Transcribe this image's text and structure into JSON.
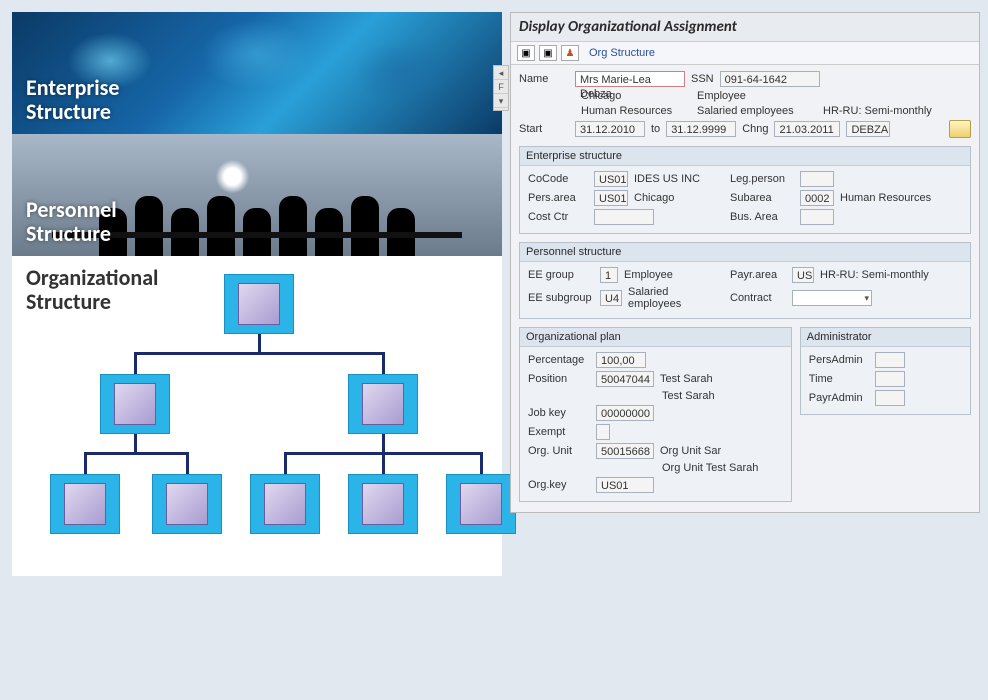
{
  "left": {
    "enterprise_label": "Enterprise\nStructure",
    "personnel_label": "Personnel\nStructure",
    "org_label": "Organizational\nStructure"
  },
  "sap": {
    "title": "Display Organizational Assignment",
    "toolbar_link": "Org Structure",
    "header": {
      "name_label": "Name",
      "name_value": "Mrs Marie-Lea Debza",
      "ssn_label": "SSN",
      "ssn_value": "091-64-1642",
      "city": "Chicago",
      "role": "Employee",
      "dept": "Human Resources",
      "payroll_type": "Salaried employees",
      "payroll_area_text": "HR-RU: Semi-monthly",
      "start_label": "Start",
      "start_value": "31.12.2010",
      "to_label": "to",
      "end_value": "31.12.9999",
      "chng_label": "Chng",
      "chng_value": "21.03.2011",
      "chng_user": "DEBZA"
    },
    "enterprise": {
      "title": "Enterprise structure",
      "cocode_label": "CoCode",
      "cocode_value": "US01",
      "cocode_text": "IDES US INC",
      "legperson_label": "Leg.person",
      "persarea_label": "Pers.area",
      "persarea_value": "US01",
      "persarea_text": "Chicago",
      "subarea_label": "Subarea",
      "subarea_value": "0002",
      "subarea_text": "Human Resources",
      "costctr_label": "Cost Ctr",
      "busarea_label": "Bus. Area"
    },
    "personnel": {
      "title": "Personnel structure",
      "eegroup_label": "EE group",
      "eegroup_value": "1",
      "eegroup_text": "Employee",
      "payrarea_label": "Payr.area",
      "payrarea_value": "US",
      "payrarea_text": "HR-RU: Semi-monthly",
      "eesubgroup_label": "EE subgroup",
      "eesubgroup_value": "U4",
      "eesubgroup_text": "Salaried employees",
      "contract_label": "Contract"
    },
    "orgplan": {
      "title": "Organizational plan",
      "percentage_label": "Percentage",
      "percentage_value": "100,00",
      "position_label": "Position",
      "position_value": "50047044",
      "position_text1": "Test Sarah",
      "position_text2": "Test Sarah",
      "jobkey_label": "Job key",
      "jobkey_value": "00000000",
      "exempt_label": "Exempt",
      "orgunit_label": "Org. Unit",
      "orgunit_value": "50015668",
      "orgunit_text1": "Org Unit Sar",
      "orgunit_text2": "Org Unit Test Sarah",
      "orgkey_label": "Org.key",
      "orgkey_value": "US01"
    },
    "admin": {
      "title": "Administrator",
      "persadmin_label": "PersAdmin",
      "time_label": "Time",
      "payradmin_label": "PayrAdmin"
    }
  }
}
